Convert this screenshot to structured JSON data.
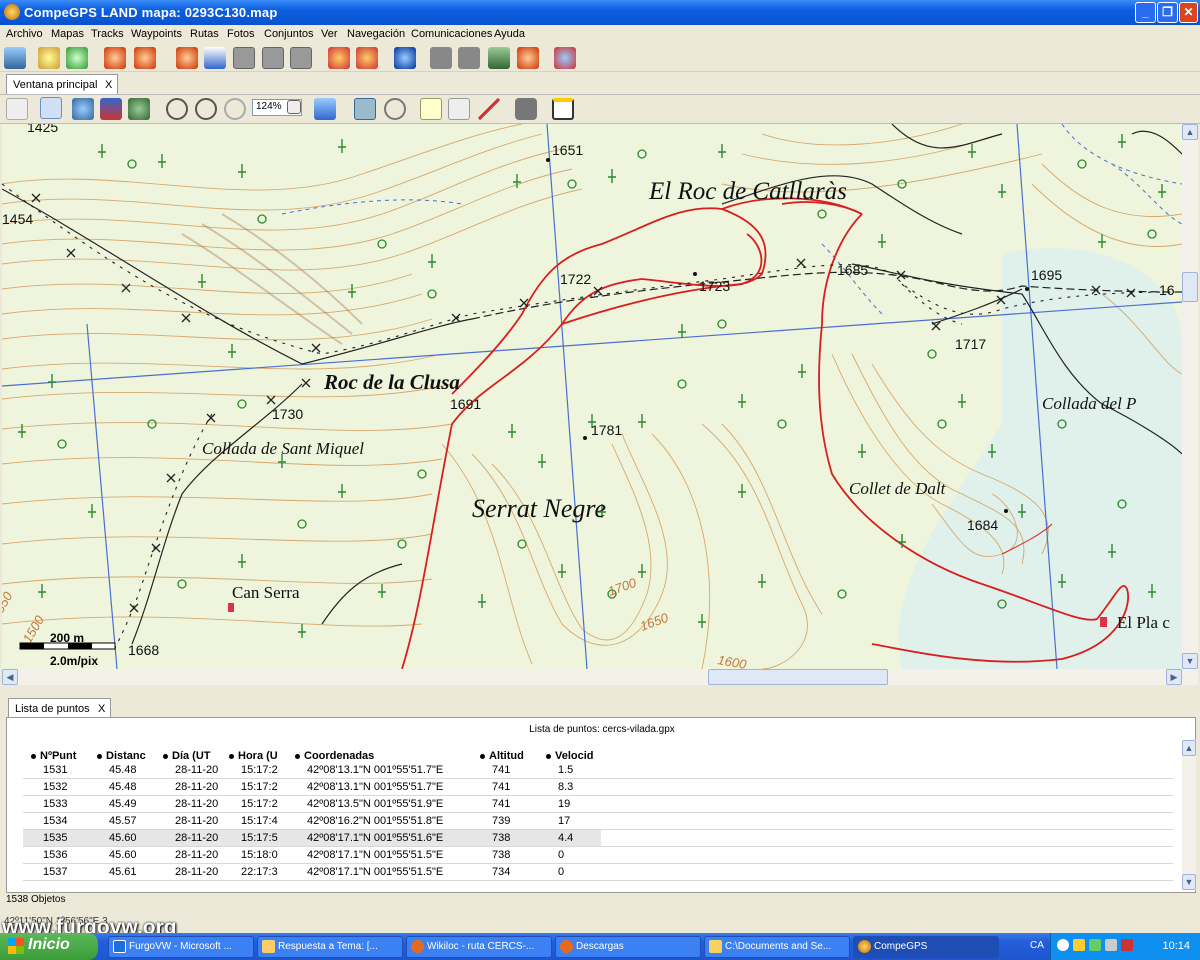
{
  "window": {
    "title": "CompeGPS LAND mapa: 0293C130.map",
    "min_icon": "minimize-icon",
    "max_icon": "maximize-icon",
    "close_icon": "close-icon"
  },
  "menu": [
    "Archivo",
    "Mapas",
    "Tracks",
    "Waypoints",
    "Rutas",
    "Fotos",
    "Conjuntos",
    "Ver",
    "Navegación",
    "Comunicaciones",
    "Ayuda"
  ],
  "main_tab": {
    "label": "Ventana principal",
    "close": "X"
  },
  "zoom": {
    "value": "124%"
  },
  "map": {
    "labels": {
      "roc_catllaras": "El Roc de Catllaràs",
      "roc_clusa": "Roc de la Clusa",
      "sant_miquel": "Collada de Sant Miquel",
      "serrat_negre": "Serrat Negre",
      "collet_dalt": "Collet de Dalt",
      "collada_p": "Collada del P",
      "can_serra": "Can Serra",
      "el_pla": "El Pla c"
    },
    "elevations": {
      "e1425": "1425",
      "e1454": "1454",
      "e1651": "1651",
      "e1722": "1722",
      "e1723": "1723",
      "e1685": "1685",
      "e1695": "1695",
      "e1717": "1717",
      "e1730": "1730",
      "e1691": "1691",
      "e1781": "1781",
      "e1684": "1684",
      "e1668": "1668",
      "e1700": "1700",
      "e1650": "1650",
      "e1600": "1600",
      "e850": "850",
      "e1500": "1500",
      "e1_right": "16"
    },
    "scale": {
      "distance": "200 m",
      "resolution": "2.0m/pix"
    }
  },
  "points_panel": {
    "tab_label": "Lista de puntos",
    "close": "X",
    "title": "Lista de puntos: cercs-vilada.gpx",
    "columns": [
      "NºPunt",
      "Distanc",
      "Día (UT",
      "Hora (U",
      "Coordenadas",
      "Altitud",
      "Velocid"
    ],
    "rows": [
      [
        "1531",
        "45.48",
        "28-11-20",
        "15:17:2",
        "42º08'13.1\"N 001º55'51.7\"E",
        "741",
        "1.5"
      ],
      [
        "1532",
        "45.48",
        "28-11-20",
        "15:17:2",
        "42º08'13.1\"N 001º55'51.7\"E",
        "741",
        "8.3"
      ],
      [
        "1533",
        "45.49",
        "28-11-20",
        "15:17:2",
        "42º08'13.5\"N 001º55'51.9\"E",
        "741",
        "19"
      ],
      [
        "1534",
        "45.57",
        "28-11-20",
        "15:17:4",
        "42º08'16.2\"N 001º55'51.8\"E",
        "739",
        "17"
      ],
      [
        "1535",
        "45.60",
        "28-11-20",
        "15:17:5",
        "42º08'17.1\"N 001º55'51.6\"E",
        "738",
        "4.4"
      ],
      [
        "1536",
        "45.60",
        "28-11-20",
        "15:18:0",
        "42º08'17.1\"N 001º55'51.5\"E",
        "738",
        "0"
      ],
      [
        "1537",
        "45.61",
        "28-11-20",
        "22:17:3",
        "42º08'17.1\"N 001º55'51.5\"E",
        "734",
        "0"
      ]
    ],
    "selected_row": 4,
    "object_count": "1538 Objetos"
  },
  "status": {
    "coords": "42º11'50\"N 1º56'56\"E 3"
  },
  "watermark": "www.furgovw.org",
  "taskbar": {
    "start": "Inicio",
    "tasks": [
      "FurgoVW - Microsoft ...",
      "Respuesta a Tema: [...",
      "Wikiloc - ruta CERCS-...",
      "Descargas",
      "C:\\Documents and Se...",
      "CompeGPS"
    ],
    "lang": "CA",
    "clock": "10:14"
  }
}
